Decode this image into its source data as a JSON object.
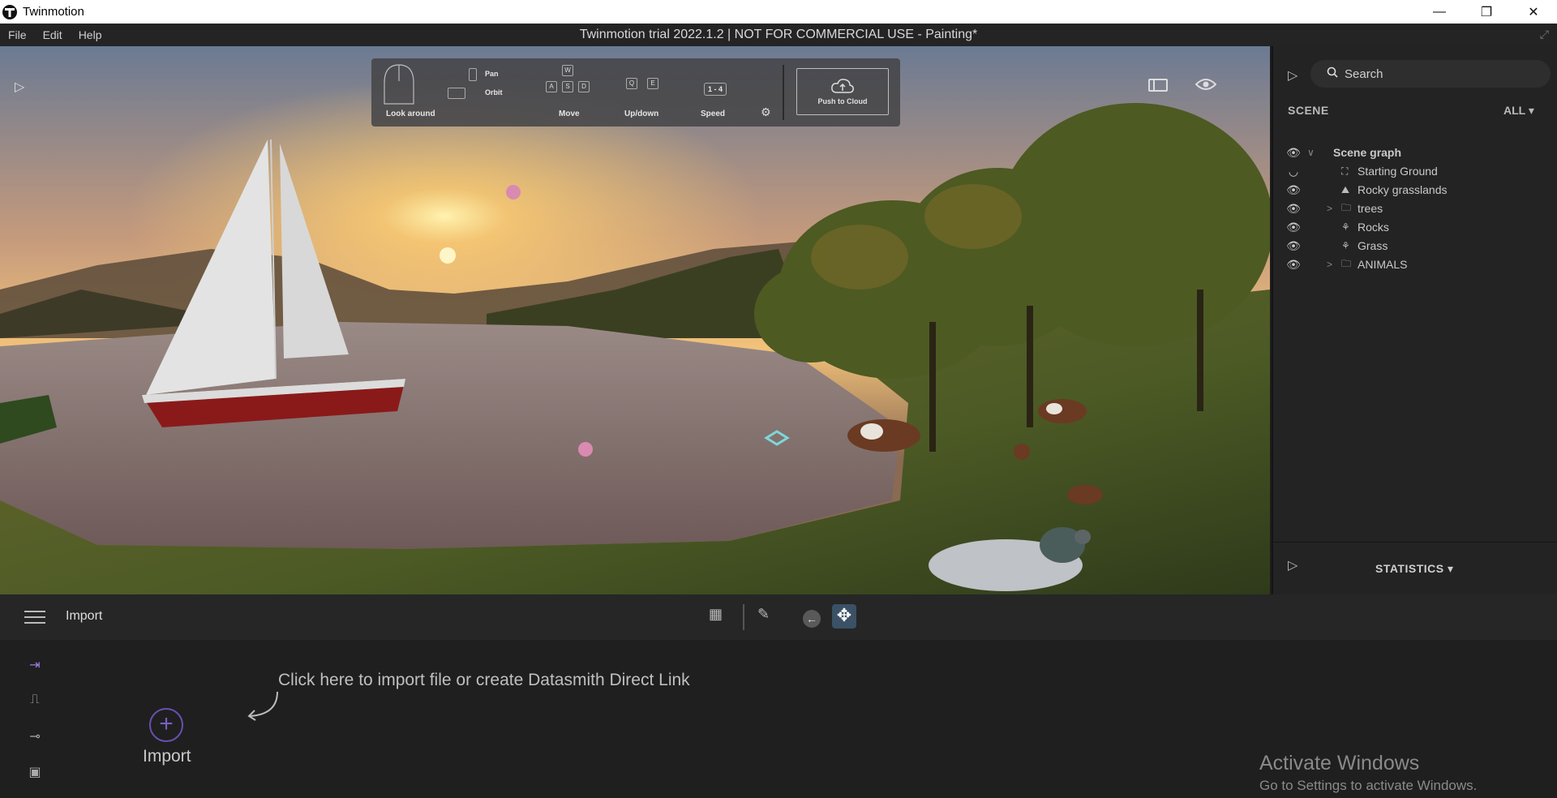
{
  "window": {
    "app_name": "Twinmotion",
    "minimize": "—",
    "maximize": "❐",
    "close": "✕"
  },
  "menu": {
    "items": [
      "File",
      "Edit",
      "Help"
    ],
    "document_title": "Twinmotion trial 2022.1.2 | NOT FOR COMMERCIAL USE - Painting*"
  },
  "hud": {
    "look_around": "Look around",
    "pan": "Pan",
    "orbit": "Orbit",
    "move": "Move",
    "updown": "Up/down",
    "speed": "Speed",
    "speed_keys": "1 - 4",
    "push_to_cloud": "Push to Cloud",
    "keys": {
      "w": "W",
      "a": "A",
      "s": "S",
      "d": "D",
      "q": "Q",
      "e": "E"
    }
  },
  "right_panel": {
    "search_placeholder": "Search",
    "scene_header": "SCENE",
    "filter": "ALL",
    "tree": [
      {
        "label": "Scene graph",
        "icon": "none",
        "expander": "down"
      },
      {
        "label": "Starting Ground",
        "icon": "ground-icon",
        "expander": "none"
      },
      {
        "label": "Rocky grasslands",
        "icon": "landscape-icon",
        "expander": "none"
      },
      {
        "label": "trees",
        "icon": "folder-icon",
        "expander": "right"
      },
      {
        "label": "Rocks",
        "icon": "scatter-icon",
        "expander": "none"
      },
      {
        "label": "Grass",
        "icon": "scatter-icon",
        "expander": "none"
      },
      {
        "label": "ANIMALS",
        "icon": "folder-icon",
        "expander": "right"
      }
    ],
    "statistics": "STATISTICS"
  },
  "toolbar": {
    "section_title": "Import"
  },
  "import_panel": {
    "hint": "Click here to import file or create Datasmith Direct Link",
    "import_label": "Import"
  },
  "watermark": {
    "title": "Activate Windows",
    "subtitle": "Go to Settings to activate Windows."
  },
  "colors": {
    "accent_purple": "#7a5ec4",
    "move_active": "#3a5166",
    "panel_bg": "#232323"
  }
}
